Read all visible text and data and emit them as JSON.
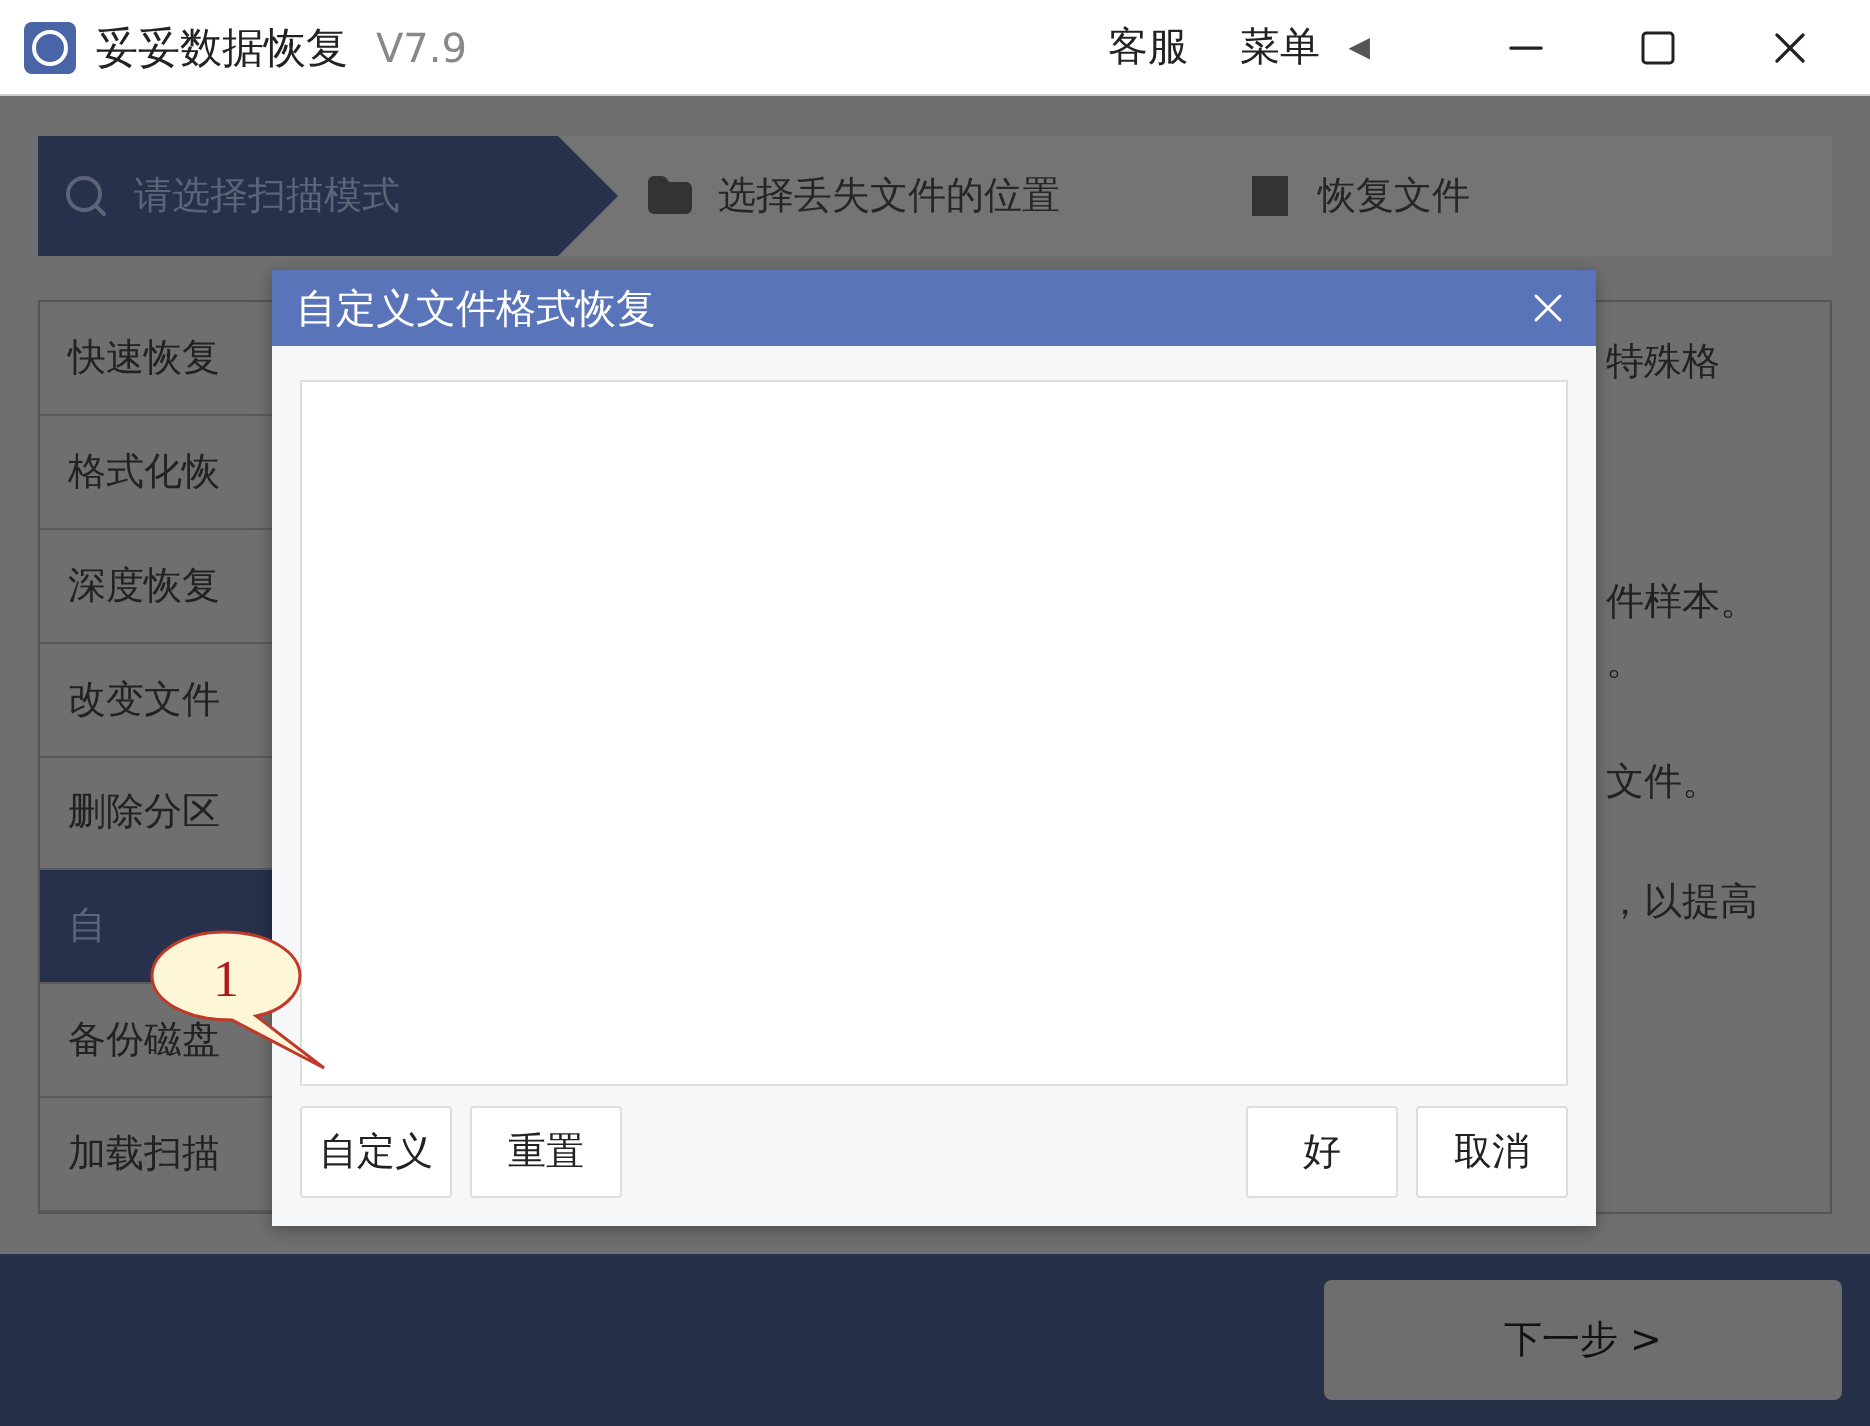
{
  "window": {
    "title": "妥妥数据恢复",
    "version": "V7.9",
    "links": [
      "客服",
      "菜单"
    ],
    "menu_arrow": "◀"
  },
  "steps": [
    {
      "label": "请选择扫描模式",
      "selected": true
    },
    {
      "label": "选择丢失文件的位置",
      "selected": false
    },
    {
      "label": "恢复文件",
      "selected": false
    }
  ],
  "modes": [
    {
      "label": "快速恢复",
      "selected": false
    },
    {
      "label": "格式化恢",
      "selected": false
    },
    {
      "label": "深度恢复",
      "selected": false
    },
    {
      "label": "改变文件",
      "selected": false
    },
    {
      "label": "删除分区",
      "selected": false
    },
    {
      "label": "自",
      "selected": true
    },
    {
      "label": "备份磁盘",
      "selected": false
    },
    {
      "label": "加载扫描",
      "selected": false
    }
  ],
  "description": [
    "特殊格",
    "件样本。",
    "。",
    "文件。",
    "，以提高"
  ],
  "dialog": {
    "title": "自定义文件格式恢复",
    "left_buttons": [
      "自定义",
      "重置"
    ],
    "right_buttons": [
      "好",
      "取消"
    ]
  },
  "callout": "1",
  "next_button": "下一步 >"
}
